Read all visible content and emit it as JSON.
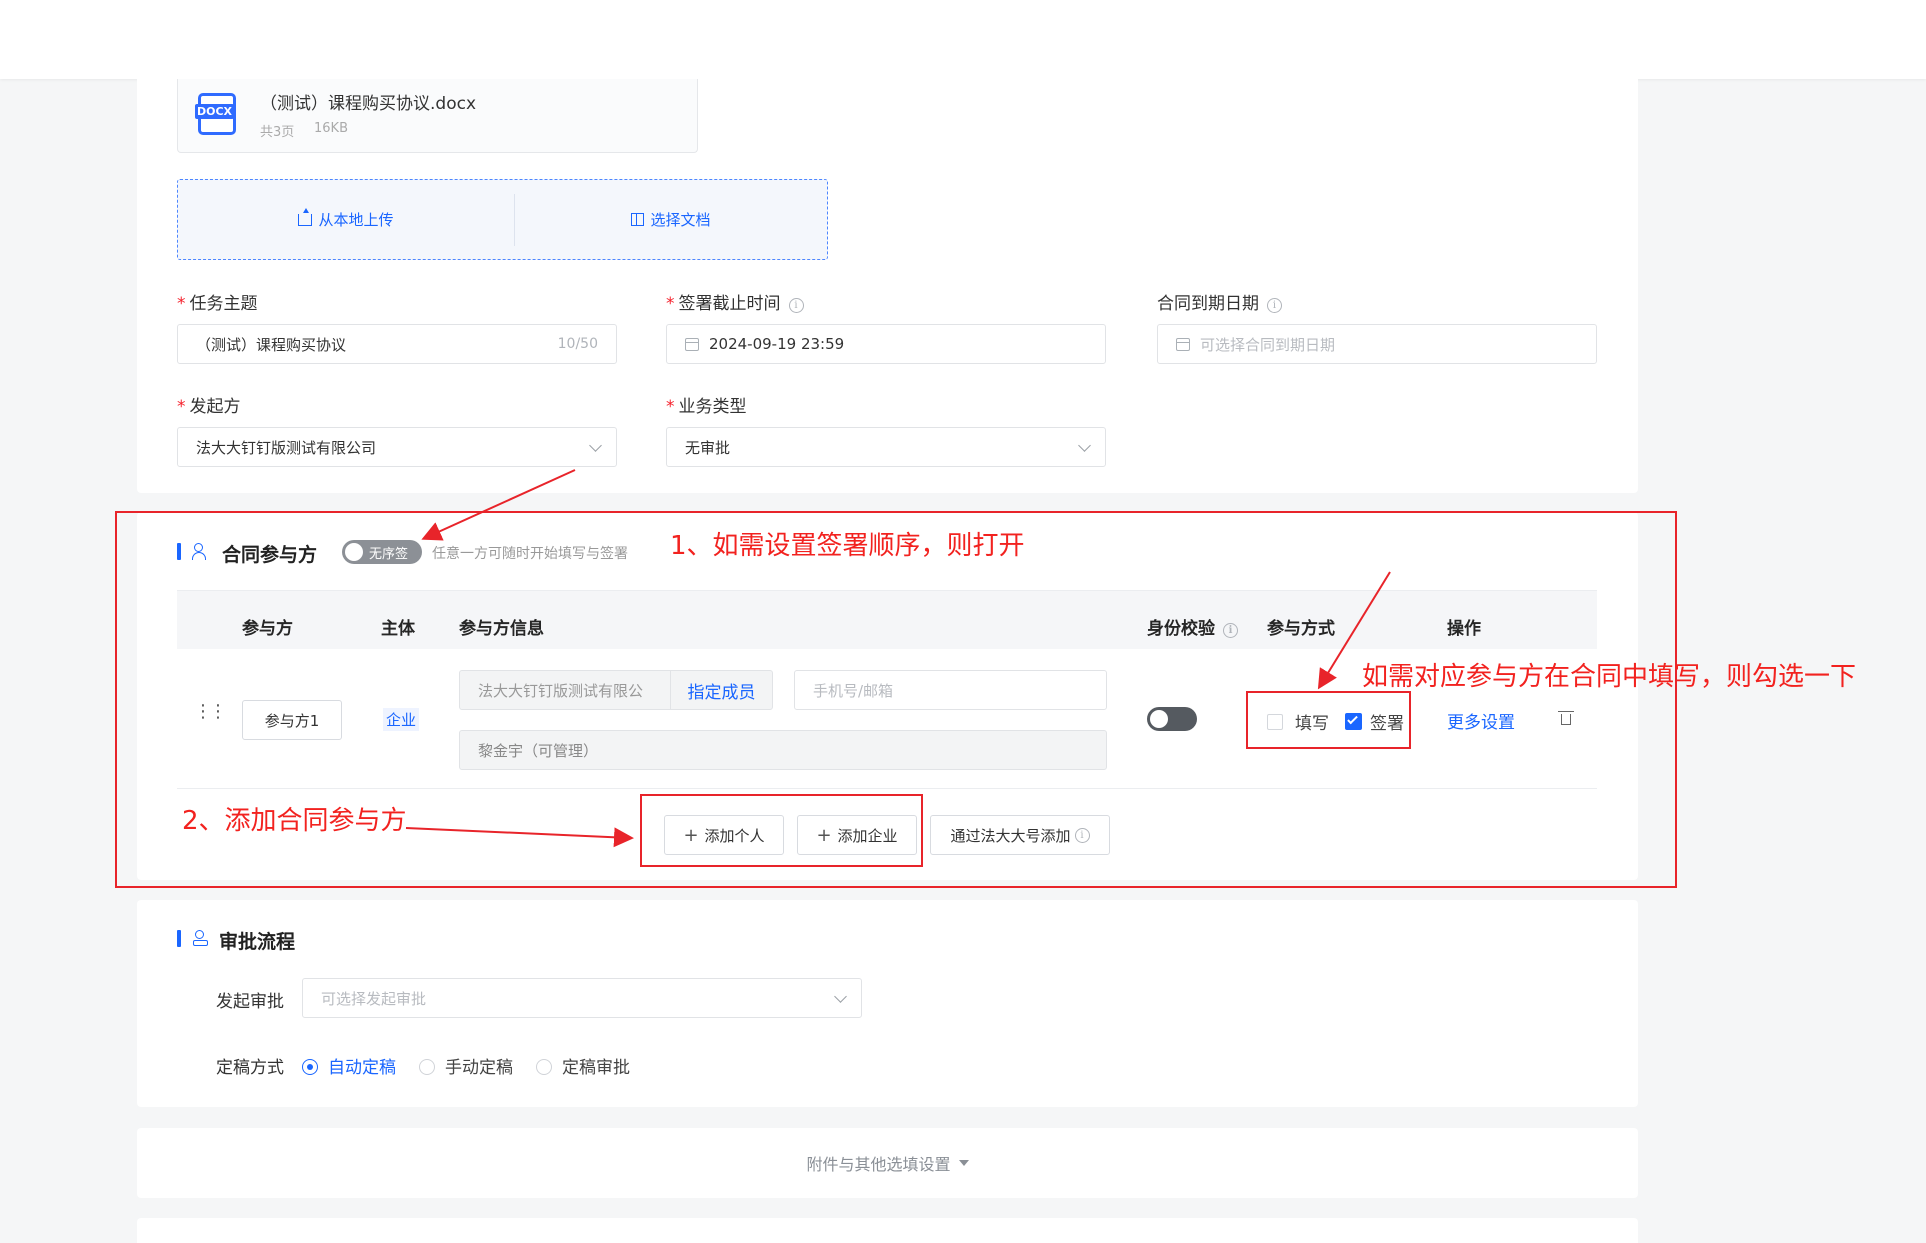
{
  "document": {
    "file_name": "（测试）课程购买协议.docx",
    "icon_label": "DOCX",
    "pages": "共3页",
    "size": "16KB",
    "upload_local": "从本地上传",
    "choose_doc": "选择文档"
  },
  "form": {
    "task_subject_label": "任务主题",
    "task_subject_value": "（测试）课程购买协议",
    "task_subject_count": "10/50",
    "deadline_label": "签署截止时间",
    "deadline_value": "2024-09-19 23:59",
    "expiry_label": "合同到期日期",
    "expiry_placeholder": "可选择合同到期日期",
    "initiator_label": "发起方",
    "initiator_value": "法大大钉钉版测试有限公司",
    "biz_type_label": "业务类型",
    "biz_type_value": "无审批"
  },
  "participants": {
    "title": "合同参与方",
    "order_toggle_label": "无序签",
    "order_hint": "任意一方可随时开始填写与签署",
    "columns": [
      "参与方",
      "主体",
      "参与方信息",
      "身份校验",
      "参与方式",
      "操作"
    ],
    "row": {
      "name": "参与方1",
      "subject": "企业",
      "company": "法大大钉钉版测试有限公",
      "assign_member": "指定成员",
      "contact_placeholder": "手机号/邮箱",
      "manager": "黎金宇（可管理）",
      "fill_label": "填写",
      "sign_label": "签署",
      "more_settings": "更多设置"
    },
    "add_person": "添加个人",
    "add_company": "添加企业",
    "add_via_fadada": "通过法大大号添加"
  },
  "approval": {
    "title": "审批流程",
    "initiate_label": "发起审批",
    "initiate_placeholder": "可选择发起审批",
    "finalize_label": "定稿方式",
    "options": [
      "自动定稿",
      "手动定稿",
      "定稿审批"
    ],
    "selected": "自动定稿"
  },
  "attachments": {
    "label": "附件与其他选填设置"
  },
  "annotations": {
    "note1": "1、如需设置签署顺序，则打开",
    "note2": "2、添加合同参与方",
    "note3": "如需对应参与方在合同中填写，则勾选一下"
  },
  "colors": {
    "primary": "#1a66ff",
    "annotation": "#e8242a"
  }
}
